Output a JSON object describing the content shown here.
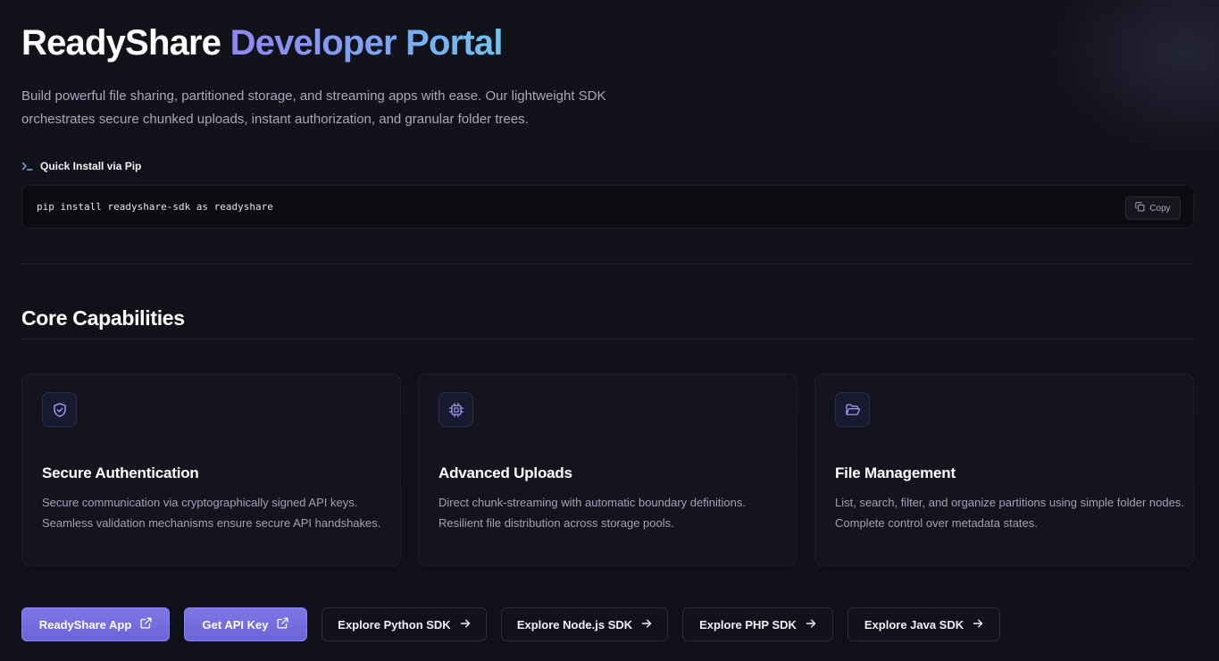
{
  "hero": {
    "title_plain": "ReadyShare",
    "title_accent": "Developer Portal",
    "description": "Build powerful file sharing, partitioned storage, and streaming apps with ease. Our lightweight SDK orchestrates secure chunked uploads, instant authorization, and granular folder trees."
  },
  "install": {
    "label": "Quick Install via Pip",
    "command": "pip install readyshare-sdk as readyshare",
    "copy_label": "Copy"
  },
  "capabilities": {
    "title": "Core Capabilities",
    "cards": [
      {
        "icon": "shield-check-icon",
        "title": "Secure Authentication",
        "description": "Secure communication via cryptographically signed API keys. Seamless validation mechanisms ensure secure API handshakes."
      },
      {
        "icon": "cpu-chip-icon",
        "title": "Advanced Uploads",
        "description": "Direct chunk-streaming with automatic boundary definitions. Resilient file distribution across storage pools."
      },
      {
        "icon": "folder-open-icon",
        "title": "File Management",
        "description": "List, search, filter, and organize partitions using simple folder nodes. Complete control over metadata states."
      }
    ]
  },
  "actions": [
    {
      "label": "ReadyShare App",
      "icon": "external-link-icon",
      "style": "primary"
    },
    {
      "label": "Get API Key",
      "icon": "external-link-icon",
      "style": "primary"
    },
    {
      "label": "Explore Python SDK",
      "icon": "arrow-right-icon",
      "style": "ghost"
    },
    {
      "label": "Explore Node.js SDK",
      "icon": "arrow-right-icon",
      "style": "ghost"
    },
    {
      "label": "Explore PHP SDK",
      "icon": "arrow-right-icon",
      "style": "ghost"
    },
    {
      "label": "Explore Java SDK",
      "icon": "arrow-right-icon",
      "style": "ghost"
    }
  ],
  "colors": {
    "background": "#0f0f17",
    "accent_start": "#8f86f2",
    "accent_end": "#6fc3ee",
    "primary_button": "#7069de"
  }
}
